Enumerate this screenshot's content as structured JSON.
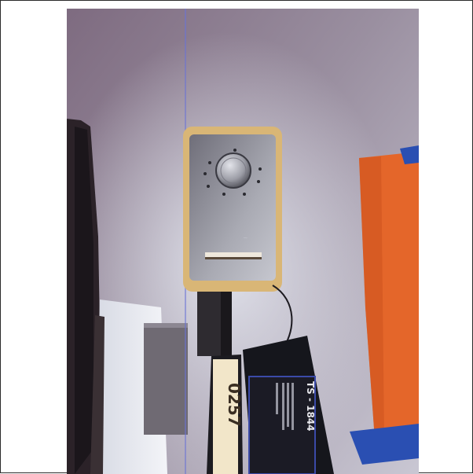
{
  "photo": {
    "subject": "wall-mounted-thermostat-with-tagged-cable",
    "tag": {
      "id_text": "TS - 1844"
    },
    "cable_label": {
      "text": "0257"
    },
    "colors": {
      "wall": "#8d7f92",
      "thermostat_body": "#d9b676",
      "thermostat_face": "#9c9ca4",
      "orange_paper": "#e4662a",
      "blue_tape": "#2a4fb2",
      "tag_black": "#15161c"
    }
  }
}
